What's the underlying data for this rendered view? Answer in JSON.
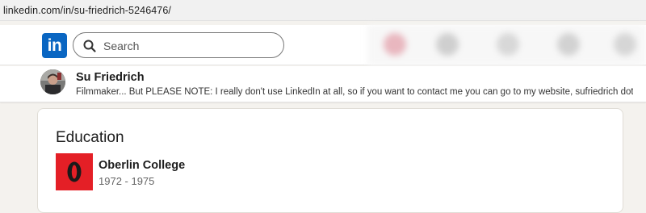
{
  "browser": {
    "url": "linkedin.com/in/su-friedrich-5246476/"
  },
  "navbar": {
    "logo_text": "in",
    "search": {
      "placeholder": "Search",
      "value": ""
    }
  },
  "profile": {
    "name": "Su Friedrich",
    "headline": "Filmmaker... But PLEASE NOTE: I really don't use LinkedIn at all, so if you want to contact me you can go to my website, sufriedrich dot co..."
  },
  "education": {
    "title": "Education",
    "entries": [
      {
        "school": "Oberlin College",
        "dates": "1972 - 1975"
      }
    ]
  },
  "colors": {
    "linkedin_blue": "#0a66c2",
    "oberlin_red": "#e41f26",
    "page_bg": "#f4f2ee"
  },
  "icons": {
    "search": "search-icon",
    "school_logo": "oberlin-logo-icon"
  }
}
